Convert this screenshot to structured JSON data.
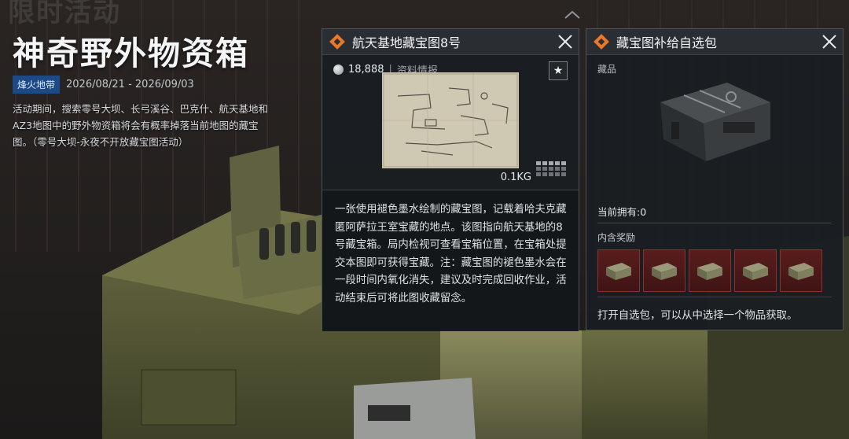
{
  "event": {
    "title": "神奇野外物资箱",
    "tag": "烽火地带",
    "date_range": "2026/08/21 - 2026/09/03",
    "description": "活动期间，搜索零号大坝、长弓溪谷、巴克什、航天基地和AZ3地图中的野外物资箱将会有概率掉落当前地图的藏宝图。（零号大坝-永夜不开放藏宝图活动）"
  },
  "map_panel": {
    "title": "航天基地藏宝图8号",
    "price": "18,888",
    "separator": "|",
    "info_label": "资料情报",
    "star_icon": "★",
    "weight": "0.1KG",
    "description": "一张使用褪色墨水绘制的藏宝图，记载着哈夫克藏匿阿萨拉王室宝藏的地点。该图指向航天基地的8号藏宝箱。局内检视可查看宝箱位置，在宝箱处提交本图即可获得宝藏。注：藏宝图的褪色墨水会在一段时间内氧化消失，建议及时完成回收作业，活动结束后可将此图收藏留念。"
  },
  "pack_panel": {
    "title": "藏宝图补给自选包",
    "section_label": "藏品",
    "owned": "当前拥有:0",
    "rewards_label": "内含奖励",
    "rewards": [
      "crate-icon",
      "crate-icon",
      "crate-icon",
      "crate-icon",
      "crate-icon"
    ],
    "footer": "打开自选包，可以从中选择一个物品获取。"
  },
  "colors": {
    "panel_bg": "#1a1e22",
    "header_bg": "#2a2e33",
    "accent_orange": "#e8782a",
    "reward_bg": "#5a1d1d",
    "tag_blue": "#1c4a86"
  }
}
